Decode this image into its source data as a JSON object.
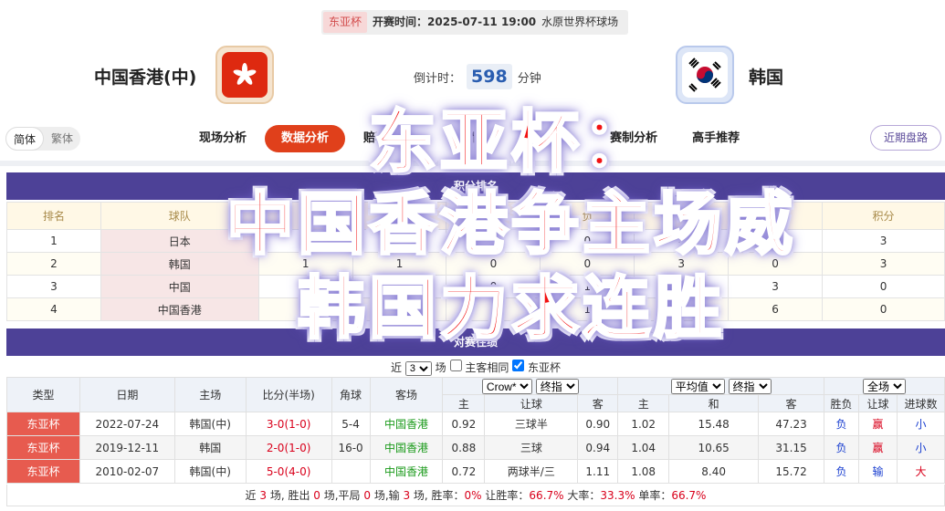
{
  "match": {
    "competition": "东亚杯",
    "kickoff": "开赛时间：2025-07-11 19:00",
    "venue": "水原世界杯球场"
  },
  "home": {
    "name": "中国香港(中)"
  },
  "away": {
    "name": "韩国"
  },
  "countdown": {
    "prefix": "倒计时：",
    "value": "598",
    "unit": "分钟"
  },
  "nav": {
    "lang_simplified": "简体",
    "lang_traditional": "繁体",
    "tabs": [
      "现场分析",
      "数据分析",
      "赔率分析",
      "阵容情报",
      "赛前分析",
      "赛制分析",
      "高手推荐"
    ],
    "active_tab": "数据分析",
    "recent_odds": "近期盘路"
  },
  "standings": {
    "title": "积分排名",
    "headers": [
      "排名",
      "球队",
      "赛",
      "胜",
      "平",
      "负",
      "得",
      "失",
      "积分"
    ],
    "rows": [
      {
        "rank": "1",
        "team": "日本",
        "played": "1",
        "win": "1",
        "draw": "0",
        "loss": "0",
        "gf": "6",
        "ga": "1",
        "pts": "3"
      },
      {
        "rank": "2",
        "team": "韩国",
        "played": "1",
        "win": "1",
        "draw": "0",
        "loss": "0",
        "gf": "3",
        "ga": "0",
        "pts": "3"
      },
      {
        "rank": "3",
        "team": "中国",
        "played": "1",
        "win": "0",
        "draw": "0",
        "loss": "1",
        "gf": "0",
        "ga": "3",
        "pts": "0"
      },
      {
        "rank": "4",
        "team": "中国香港",
        "played": "1",
        "win": "0",
        "draw": "0",
        "loss": "1",
        "gf": "1",
        "ga": "6",
        "pts": "0"
      }
    ]
  },
  "h2h": {
    "title": "对赛往绩",
    "filter": {
      "near": "近",
      "count": "3",
      "unit": "场",
      "same_home_label": "主客相同",
      "cup_label": "东亚杯"
    },
    "headers": {
      "type": "类型",
      "date": "日期",
      "home": "主场",
      "score": "比分(半场)",
      "corner": "角球",
      "away": "客场",
      "company": "Crow*",
      "odds_kind": "终指",
      "avg": "平均值",
      "avg_kind": "终指",
      "scope": "全场",
      "sub_home": "主",
      "sub_handicap": "让球",
      "sub_away": "客",
      "sub_avg_home": "主",
      "sub_avg_draw": "和",
      "sub_avg_away": "客",
      "result": "胜负",
      "handicap_res": "让球",
      "goals_res": "进球数"
    },
    "rows": [
      {
        "type": "东亚杯",
        "date": "2022-07-24",
        "home": "韩国(中)",
        "score": "3-0(1-0)",
        "corner": "5-4",
        "away": "中国香港",
        "o_home": "0.92",
        "o_line": "三球半",
        "o_away": "0.90",
        "a_home": "1.02",
        "a_draw": "15.48",
        "a_away": "47.23",
        "res": "负",
        "hres": "赢",
        "gres": "小"
      },
      {
        "type": "东亚杯",
        "date": "2019-12-11",
        "home": "韩国",
        "score": "2-0(1-0)",
        "corner": "16-0",
        "away": "中国香港",
        "o_home": "0.88",
        "o_line": "三球",
        "o_away": "0.94",
        "a_home": "1.04",
        "a_draw": "10.65",
        "a_away": "31.15",
        "res": "负",
        "hres": "赢",
        "gres": "小"
      },
      {
        "type": "东亚杯",
        "date": "2010-02-07",
        "home": "韩国(中)",
        "score": "5-0(4-0)",
        "corner": "",
        "away": "中国香港",
        "o_home": "0.72",
        "o_line": "两球半/三",
        "o_away": "1.11",
        "a_home": "1.08",
        "a_draw": "8.40",
        "a_away": "15.72",
        "res": "负",
        "hres": "输",
        "gres": "大"
      }
    ],
    "summary": {
      "p1": "近 ",
      "n_games": "3",
      "p2": " 场, 胜出 ",
      "wins": "0",
      "p3": " 场,平局 ",
      "draws": "0",
      "p4": " 场,输 ",
      "losses": "3",
      "p5": " 场, 胜率：",
      "win_rate": "0%",
      "p6": " 让胜率：",
      "hc_rate": "66.7%",
      "p7": " 大率：",
      "over_rate": "33.3%",
      "p8": " 单率：",
      "odd_rate": "66.7%"
    }
  },
  "overlay": {
    "line1": "东亚杯：",
    "line2": "中国香港争主场威",
    "line3": "韩国力求连胜"
  }
}
